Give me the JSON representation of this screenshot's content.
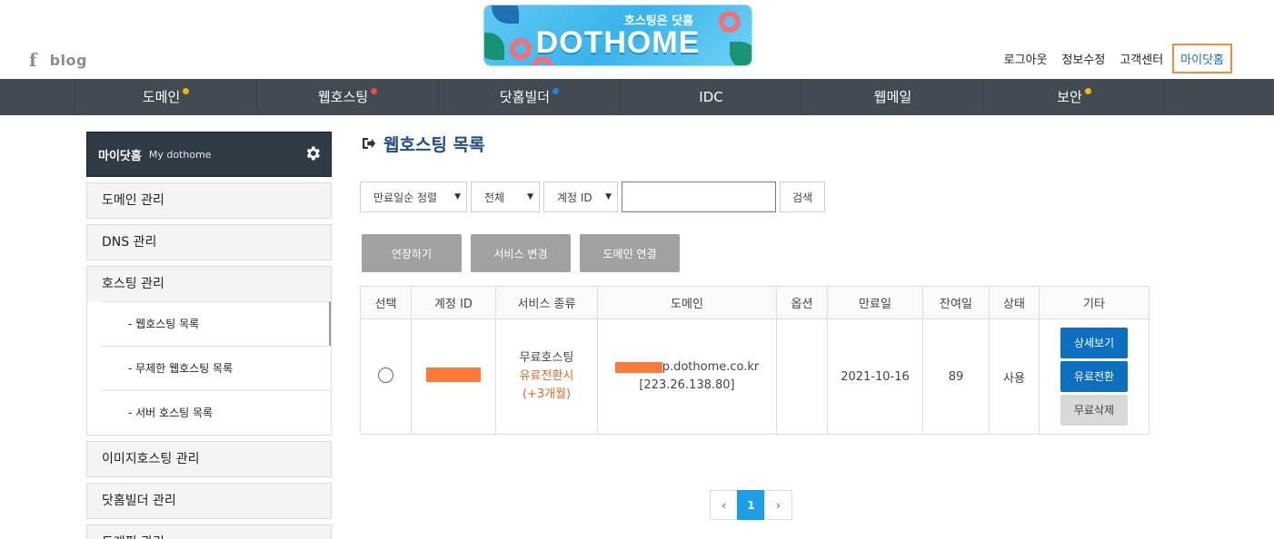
{
  "header": {
    "social": {
      "facebook": "f",
      "blog": "blog"
    },
    "logo": {
      "tagline": "호스팅은 닷홈",
      "brand": "DOTHOME"
    },
    "topnav": [
      "로그아웃",
      "정보수정",
      "고객센터",
      "마이닷홈"
    ]
  },
  "mainmenu": [
    {
      "label": "도메인",
      "dot": "#f5b800"
    },
    {
      "label": "웹호스팅",
      "dot": "#f04a4a"
    },
    {
      "label": "닷홈빌더",
      "dot": "#1f7fe0"
    },
    {
      "label": "IDC",
      "dot": ""
    },
    {
      "label": "웹메일",
      "dot": ""
    },
    {
      "label": "보안",
      "dot": "#f5b800"
    }
  ],
  "sidebar": {
    "title": "마이닷홈",
    "subtitle": "My dothome",
    "items": {
      "domain": "도메인 관리",
      "dns": "DNS 관리",
      "hosting": "호스팅 관리",
      "sub_web": "- 웹호스팅 목록",
      "sub_unlimited": "- 무제한 웹호스팅 목록",
      "sub_server": "- 서버 호스팅 목록",
      "image": "이미지호스팅 관리",
      "builder": "닷홈빌더 관리",
      "traffic": "트래픽 관리"
    }
  },
  "content": {
    "title": "웹호스팅 목록",
    "filters": {
      "sort": "만료일순 정렬",
      "type": "전체",
      "field": "계정 ID",
      "search_value": "",
      "search_button": "검색"
    },
    "actions": [
      "연장하기",
      "서비스 변경",
      "도메인 연결"
    ],
    "table": {
      "headers": [
        "선택",
        "계정 ID",
        "서비스 종류",
        "도메인",
        "옵션",
        "만료일",
        "잔여일",
        "상태",
        "기타"
      ],
      "row": {
        "service_type": "무료호스팅",
        "service_note1": "유료전환시",
        "service_note2": "(+3개월)",
        "domain": "p.dothome.co.kr",
        "ip": "[223.26.138.80]",
        "option": "",
        "expire": "2021-10-16",
        "remaining": "89",
        "status": "사용",
        "btn_detail": "상세보기",
        "btn_upgrade": "유료전환",
        "btn_delete": "무료삭제"
      }
    },
    "pagination": {
      "prev": "‹",
      "current": "1",
      "next": "›"
    }
  },
  "colors": {
    "menu_bg": "#434b52",
    "accent_blue": "#0d6fbf",
    "redact": "#ff7a3a",
    "highlight_border": "#f08c3c"
  }
}
